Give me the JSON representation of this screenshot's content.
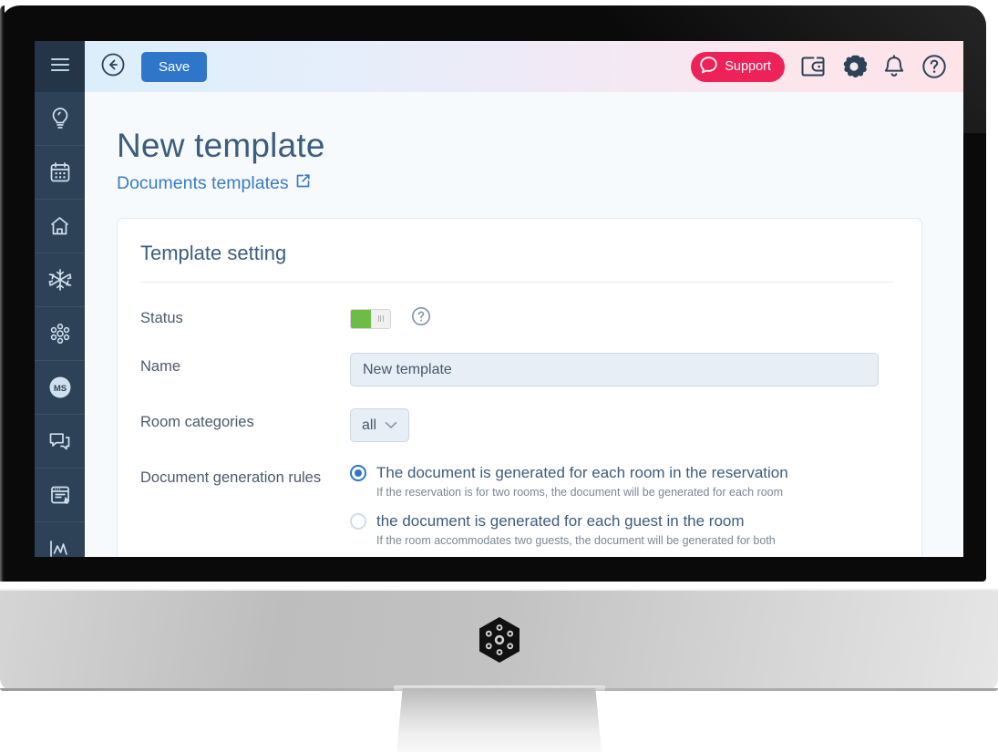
{
  "sidebar": {
    "menu_icon": "hamburger-menu-icon",
    "items": [
      {
        "icon": "lightbulb-idea-icon",
        "name": "ideas"
      },
      {
        "icon": "calendar-icon",
        "name": "calendar"
      },
      {
        "icon": "home-icon",
        "name": "home"
      },
      {
        "icon": "snowflake-icon",
        "name": "snowflake"
      },
      {
        "icon": "molecule-hexagon-icon",
        "name": "modules"
      },
      {
        "icon": "ms-badge-icon",
        "name": "ms",
        "label": "MS"
      },
      {
        "icon": "chat-messages-icon",
        "name": "messages"
      },
      {
        "icon": "document-cursor-icon",
        "name": "documents"
      },
      {
        "icon": "chart-line-icon",
        "name": "analytics"
      }
    ]
  },
  "topbar": {
    "back_icon": "arrow-left-circle-icon",
    "save_label": "Save",
    "support_label": "Support",
    "support_icon": "chat-bubble-icon",
    "icons": [
      {
        "name": "wallet-export-icon"
      },
      {
        "name": "gear-settings-icon"
      },
      {
        "name": "bell-notifications-icon"
      },
      {
        "name": "help-circle-icon"
      }
    ],
    "colors": {
      "save_bg": "#2f76c9",
      "support_bg": "#ee2158",
      "gradient_start": "#dceefb",
      "gradient_end": "#fde4e8"
    }
  },
  "page": {
    "title": "New template",
    "breadcrumb_label": "Documents templates",
    "breadcrumb_icon": "external-link-icon"
  },
  "card": {
    "title": "Template setting",
    "status": {
      "label": "Status",
      "toggle_on": true,
      "help_icon": "help-circle-icon",
      "on_color": "#6cbd45"
    },
    "name": {
      "label": "Name",
      "value": "New template",
      "placeholder": "New template"
    },
    "room_categories": {
      "label": "Room categories",
      "selected": "all",
      "chevron_icon": "chevron-down-icon"
    },
    "generation_rules": {
      "label": "Document generation rules",
      "options": [
        {
          "label": "The document is generated for each room in the reservation",
          "description": "If the reservation is for two rooms, the document will be generated for each room",
          "selected": true
        },
        {
          "label": "the document is generated for each guest in the room",
          "description": "If the room accommodates two guests, the document will be generated for both",
          "selected": false
        }
      ]
    }
  },
  "device": {
    "logo_icon": "hexagon-logo-icon"
  }
}
